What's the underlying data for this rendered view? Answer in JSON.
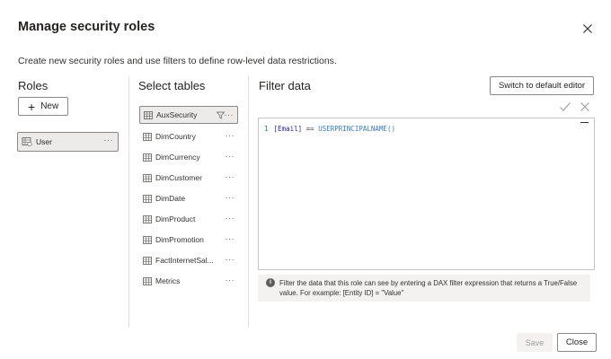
{
  "dialog": {
    "title": "Manage security roles",
    "subtitle": "Create new security roles and use filters to define row-level data restrictions."
  },
  "roles": {
    "heading": "Roles",
    "new_label": "New",
    "items": [
      {
        "label": "User",
        "more": "···"
      }
    ]
  },
  "tables": {
    "heading": "Select tables",
    "more": "···",
    "items": [
      {
        "label": "AuxSecurity",
        "selected": true,
        "has_filter": true
      },
      {
        "label": "DimCountry"
      },
      {
        "label": "DimCurrency"
      },
      {
        "label": "DimCustomer"
      },
      {
        "label": "DimDate"
      },
      {
        "label": "DimProduct"
      },
      {
        "label": "DimPromotion"
      },
      {
        "label": "FactInternetSal..."
      },
      {
        "label": "Metrics"
      }
    ]
  },
  "filter": {
    "heading": "Filter data",
    "switch_label": "Switch to default editor",
    "code": {
      "line_number": "1",
      "field": "[Email]",
      "operator": "==",
      "function": "USERPRINCIPALNAME()"
    },
    "info_icon_text": "i",
    "info": "Filter the data that this role can see by entering a DAX filter expression that returns a True/False value. For example: [Entity ID] = \"Value\""
  },
  "footer": {
    "save_label": "Save",
    "close_label": "Close"
  }
}
